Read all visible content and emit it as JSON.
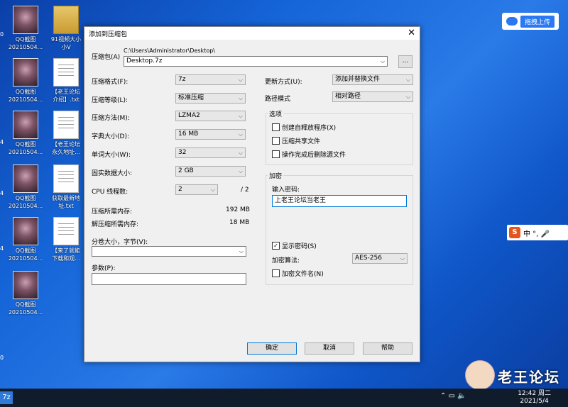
{
  "desktop": {
    "icons": [
      {
        "name": "QQ截图",
        "sub": "20210504..."
      },
      {
        "name": "91视频大小",
        "sub": "小V"
      },
      {
        "name": "QQ截图",
        "sub": "20210504..."
      },
      {
        "name": "【老王论坛",
        "sub": "介绍】.txt"
      },
      {
        "name": "QQ截图",
        "sub": "20210504..."
      },
      {
        "name": "【老王论坛",
        "sub": "永久地址..."
      },
      {
        "name": "QQ截图",
        "sub": "20210504..."
      },
      {
        "name": "获取最新地",
        "sub": "址.txt"
      },
      {
        "name": "QQ截图",
        "sub": "20210504..."
      },
      {
        "name": "【来了就能",
        "sub": "下载和观..."
      },
      {
        "name": "QQ截图",
        "sub": "20210504..."
      }
    ],
    "edge_labels": [
      "0",
      "4",
      "4",
      "4",
      "0"
    ]
  },
  "baidu": {
    "upload_label": "拖拽上传"
  },
  "ime": {
    "label": "中 °, 🎤"
  },
  "brand": {
    "text": "老王论坛"
  },
  "taskbar": {
    "start": "7z",
    "tray": "⌃ ▭ 🔈",
    "time": "12:42 周二",
    "date": "2021/5/4"
  },
  "dialog": {
    "title": "添加到压缩包",
    "close": "✕",
    "archive_label": "压缩包(A)",
    "archive_path": "C:\\Users\\Administrator\\Desktop\\",
    "archive_name": "Desktop.7z",
    "browse": "...",
    "left": [
      {
        "label": "压缩格式(F):",
        "value": "7z"
      },
      {
        "label": "压缩等级(L):",
        "value": "标准压缩"
      },
      {
        "label": "压缩方法(M):",
        "value": "LZMA2"
      },
      {
        "label": "字典大小(D):",
        "value": "16 MB"
      },
      {
        "label": "单词大小(W):",
        "value": "32"
      },
      {
        "label": "固实数据大小:",
        "value": "2 GB"
      }
    ],
    "cpu_label": "CPU 线程数:",
    "cpu_value": "2",
    "cpu_total": "/ 2",
    "mem_comp_label": "压缩所需内存:",
    "mem_comp_value": "192 MB",
    "mem_decomp_label": "解压缩所需内存:",
    "mem_decomp_value": "18 MB",
    "split_label": "分卷大小，字节(V):",
    "params_label": "参数(P):",
    "update_label": "更新方式(U):",
    "update_value": "添加并替换文件",
    "path_label": "路径模式",
    "path_value": "相对路径",
    "options_title": "选项",
    "options": [
      {
        "label": "创建自释放程序(X)",
        "checked": false
      },
      {
        "label": "压缩共享文件",
        "checked": false
      },
      {
        "label": "操作完成后删除源文件",
        "checked": false
      }
    ],
    "encrypt_title": "加密",
    "password_label": "输入密码:",
    "password_value": "上老王论坛当老王",
    "show_password": "显示密码(S)",
    "enc_method_label": "加密算法:",
    "enc_method_value": "AES-256",
    "encrypt_names": "加密文件名(N)",
    "ok": "确定",
    "cancel": "取消",
    "help": "帮助"
  }
}
